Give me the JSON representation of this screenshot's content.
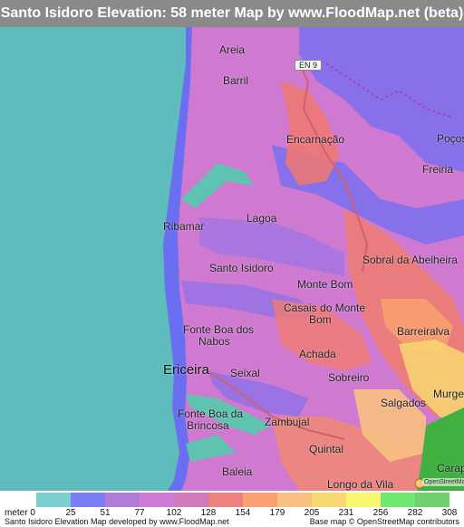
{
  "title": "Santo Isidoro Elevation: 58 meter Map by www.FloodMap.net (beta)",
  "map": {
    "places": [
      {
        "name": "Areia",
        "key": "areia"
      },
      {
        "name": "Barril",
        "key": "barril"
      },
      {
        "name": "Encarnação",
        "key": "encarnacao"
      },
      {
        "name": "Poços",
        "key": "pocos"
      },
      {
        "name": "Freiria",
        "key": "freiria"
      },
      {
        "name": "Ribamar",
        "key": "ribamar"
      },
      {
        "name": "Lagoa",
        "key": "lagoa"
      },
      {
        "name": "Sobral da Abelheira",
        "key": "sobral"
      },
      {
        "name": "Santo Isidoro",
        "key": "santo-isidoro"
      },
      {
        "name": "Monte Bom",
        "key": "monte-bom"
      },
      {
        "name": "Casais do Monte",
        "key": "casais-1"
      },
      {
        "name": "Bom",
        "key": "casais-2"
      },
      {
        "name": "Barreiralva",
        "key": "barreiralva"
      },
      {
        "name": "Fonte Boa dos",
        "key": "fonte-boa-1"
      },
      {
        "name": "Nabos",
        "key": "fonte-boa-2"
      },
      {
        "name": "Achada",
        "key": "achada"
      },
      {
        "name": "Ericeira",
        "key": "ericeira"
      },
      {
        "name": "Seixal",
        "key": "seixal"
      },
      {
        "name": "Sobreiro",
        "key": "sobreiro"
      },
      {
        "name": "Murgeira",
        "key": "murgeira"
      },
      {
        "name": "Salgados",
        "key": "salgados"
      },
      {
        "name": "Fonte Boa da",
        "key": "fonte-boa-da-1"
      },
      {
        "name": "Brincosa",
        "key": "fonte-boa-da-2"
      },
      {
        "name": "Zambujal",
        "key": "zambujal"
      },
      {
        "name": "Quintal",
        "key": "quintal"
      },
      {
        "name": "Baleia",
        "key": "baleia"
      },
      {
        "name": "Longo da Vila",
        "key": "longo-da-vila"
      },
      {
        "name": "Carap",
        "key": "carap"
      }
    ],
    "road_label": "EN 9",
    "osm_logo": "OpenStreetMap",
    "colors": {
      "sea": "#5bbdbd",
      "low": "#6e6ef0",
      "mid": "#d07ac8",
      "high": "#f08070",
      "peak": "#40c040"
    }
  },
  "legend": {
    "unit": "meter",
    "ticks": [
      "0",
      "25",
      "51",
      "77",
      "102",
      "128",
      "154",
      "179",
      "205",
      "231",
      "256",
      "282",
      "308"
    ],
    "colors": [
      "#7ccfcf",
      "#7c7cf5",
      "#b07ad8",
      "#cf7ad6",
      "#d07ab8",
      "#f08080",
      "#f8a070",
      "#f8c080",
      "#f8d870",
      "#f8f870",
      "#70e870",
      "#70d070"
    ]
  },
  "credits": {
    "left": "Santo Isidoro Elevation Map developed by www.FloodMap.net",
    "right": "Base map © OpenStreetMap contributors"
  }
}
